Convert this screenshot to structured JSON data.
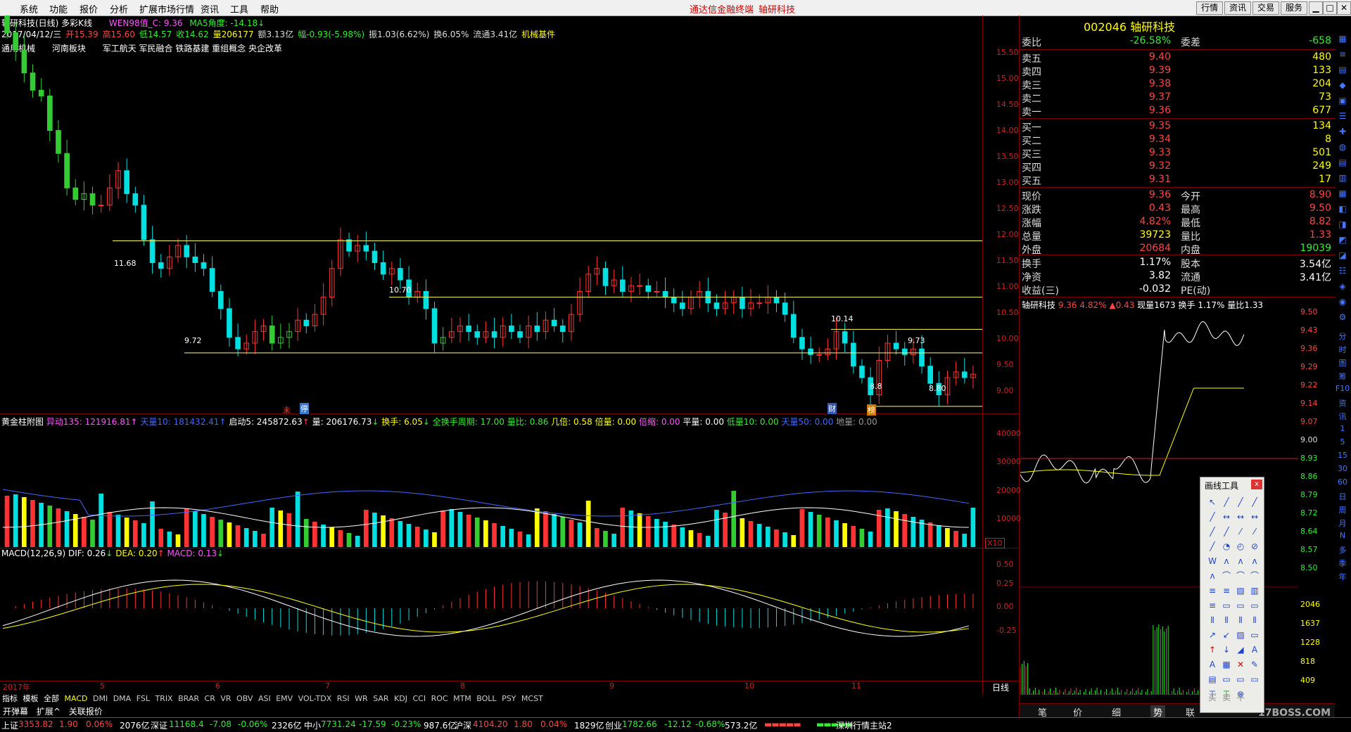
{
  "menu": {
    "items": [
      "系统",
      "功能",
      "报价",
      "分析",
      "扩展市场行情",
      "资讯",
      "工具",
      "帮助"
    ],
    "promo1": "通达信金融终端",
    "promo2": "轴研科技",
    "buttons": [
      "行情",
      "资讯",
      "交易",
      "服务"
    ]
  },
  "chart_header": {
    "title": "轴研科技(日线) 多彩K线",
    "wen": "WEN98值_C: 9.36",
    "ma5": "MA5角度: -14.18"
  },
  "day_info": {
    "date": "2017/04/12/三",
    "open": "开15.39",
    "high": "高15.60",
    "low": "低14.57",
    "close": "收14.62",
    "vol": "量206177",
    "amt": "额3.13亿",
    "chg": "幅-0.93(-5.98%)",
    "amp": "振1.03(6.62%)",
    "turn": "换6.05%",
    "float": "流通3.41亿",
    "industry": "机械基件"
  },
  "concepts": {
    "a": "通用机械",
    "b": "河南板块",
    "c": "军工航天 军民融合 铁路基建 重组概念 央企改革"
  },
  "price_axis": [
    "15.50",
    "15.00",
    "14.50",
    "14.00",
    "13.50",
    "13.00",
    "12.50",
    "12.00",
    "11.50",
    "11.00",
    "10.50",
    "10.00",
    "9.50",
    "9.00"
  ],
  "level_labels": {
    "l1": "11.68",
    "l2": "10.70",
    "l3": "10.14",
    "l4": "9.73",
    "l5": "9.72",
    "l6": "8.80",
    "l7": "8.8"
  },
  "event_markers": {
    "m1": "未",
    "m2": "停",
    "m3": "财",
    "m4": "榜"
  },
  "vol_ind": {
    "name": "黄金柱附图",
    "i1": "异动135: 121916.81",
    "i2": "天量10: 181432.41",
    "i3": "启动5: 245872.63",
    "i4": "量: 206176.73",
    "i5": "换手: 6.05",
    "i6": "全换手周期: 17.00",
    "i7": "量比: 0.86",
    "i8": "几倍: 0.58",
    "i9": "倍量: 0.00",
    "i10": "倍缩: 0.00",
    "i11": "平量: 0.00",
    "i12": "低量10: 0.00",
    "i13": "天量50: 0.00",
    "i14": "地量: 0.00"
  },
  "vol_axis": [
    "40000",
    "30000",
    "20000",
    "10000",
    "X10"
  ],
  "macd": {
    "name": "MACD(12,26,9)",
    "dif": "DIF: 0.26",
    "dea": "DEA: 0.20",
    "macd": "MACD: 0.13"
  },
  "macd_axis": [
    "0.50",
    "0.25",
    "0.00",
    "-0.25"
  ],
  "time_axis": [
    "2017年",
    "5",
    "6",
    "7",
    "8",
    "9",
    "10",
    "11"
  ],
  "period_label": "日线",
  "indicator_tabs": [
    "指标",
    "模板",
    "全部",
    "MACD",
    "DMI",
    "DMA",
    "FSL",
    "TRIX",
    "BRAR",
    "CR",
    "VR",
    "OBV",
    "ASI",
    "EMV",
    "VOL-TDX",
    "RSI",
    "WR",
    "SAR",
    "KDJ",
    "CCI",
    "ROC",
    "MTM",
    "BOLL",
    "PSY",
    "MCST"
  ],
  "bottom_tabs": [
    "开弹幕",
    "扩展^",
    "关联报价"
  ],
  "quote": {
    "code_name": "002046 轴研科技",
    "webi": {
      "l": "委比",
      "v": "-26.58%",
      "l2": "委差",
      "v2": "-658"
    },
    "asks": [
      {
        "l": "卖五",
        "p": "9.40",
        "v": "480"
      },
      {
        "l": "卖四",
        "p": "9.39",
        "v": "133"
      },
      {
        "l": "卖三",
        "p": "9.38",
        "v": "204"
      },
      {
        "l": "卖二",
        "p": "9.37",
        "v": "73"
      },
      {
        "l": "卖一",
        "p": "9.36",
        "v": "677"
      }
    ],
    "bids": [
      {
        "l": "买一",
        "p": "9.35",
        "v": "134"
      },
      {
        "l": "买二",
        "p": "9.34",
        "v": "8"
      },
      {
        "l": "买三",
        "p": "9.33",
        "v": "501"
      },
      {
        "l": "买四",
        "p": "9.32",
        "v": "249"
      },
      {
        "l": "买五",
        "p": "9.31",
        "v": "17"
      }
    ],
    "stats": [
      {
        "l": "现价",
        "v": "9.36",
        "l2": "今开",
        "v2": "8.90"
      },
      {
        "l": "涨跌",
        "v": "0.43",
        "l2": "最高",
        "v2": "9.50"
      },
      {
        "l": "涨幅",
        "v": "4.82%",
        "l2": "最低",
        "v2": "8.82"
      },
      {
        "l": "总量",
        "v": "39723",
        "l2": "量比",
        "v2": "1.33"
      },
      {
        "l": "外盘",
        "v": "20684",
        "l2": "内盘",
        "v2": "19039"
      }
    ],
    "stats2": [
      {
        "l": "换手",
        "v": "1.17%",
        "l2": "股本",
        "v2": "3.54亿"
      },
      {
        "l": "净资",
        "v": "3.82",
        "l2": "流通",
        "v2": "3.41亿"
      },
      {
        "l": "收益(三)",
        "v": "-0.032",
        "l2": "PE(动)",
        "v2": ""
      }
    ]
  },
  "intraday": {
    "name": "轴研科技",
    "price": "9.36",
    "pct": "4.82%",
    "chg": "▲0.43",
    "vol": "现量1673",
    "turn": "换手 1.17%",
    "ratio": "量比1.33",
    "axis": [
      "9.50",
      "9.43",
      "9.36",
      "9.29",
      "9.22",
      "9.14",
      "9.07",
      "9.00",
      "8.93",
      "8.86",
      "8.79",
      "8.72",
      "8.64",
      "8.57",
      "8.50"
    ],
    "vaxis": [
      "2046",
      "1637",
      "1228",
      "818",
      "409"
    ]
  },
  "tool_box": {
    "title": "画线工具",
    "close": "x"
  },
  "vtools": [
    "分",
    "时",
    "图",
    "筹",
    "F10",
    "资",
    "讯",
    "1",
    "5",
    "15",
    "30",
    "60",
    "日",
    "周",
    "月",
    "N",
    "多",
    "季",
    "年"
  ],
  "right_bottom_tabs": [
    "笔",
    "价",
    "细",
    "势",
    "联"
  ],
  "watermark": "17BOSS.COM",
  "status": {
    "sh": "上证",
    "sh_v": "3353.82",
    "sh_c": "1.90",
    "sh_p": "0.06%",
    "sh_a": "2076亿",
    "sz": "深证",
    "sz_v": "11168.4",
    "sz_c": "-7.08",
    "sz_p": "-0.06%",
    "sz_a": "2326亿",
    "zx": "中小",
    "zx_v": "7731.24",
    "zx_c": "-17.59",
    "zx_p": "-0.23%",
    "zx_a": "987.6亿",
    "hs": "沪深",
    "hs_v": "4104.20",
    "hs_c": "1.80",
    "hs_p": "0.04%",
    "hs_a": "1829亿",
    "cy": "创业",
    "cy_v": "1782.66",
    "cy_c": "-12.12",
    "cy_p": "-0.68%",
    "cy_a": "573.2亿",
    "station": "深圳行情主站2"
  },
  "chart_data": {
    "type": "candlestick",
    "title": "轴研科技(日线) 多彩K线",
    "ylim": [
      8.75,
      15.6
    ],
    "closes": [
      15.3,
      15.0,
      14.6,
      14.3,
      14.2,
      13.6,
      13.2,
      12.6,
      12.4,
      12.5,
      12.3,
      12.3,
      12.6,
      12.9,
      12.5,
      12.3,
      11.7,
      11.3,
      11.2,
      11.4,
      11.6,
      11.4,
      11.3,
      11.2,
      10.8,
      10.5,
      10.0,
      9.8,
      9.9,
      10.1,
      10.2,
      9.9,
      10.0,
      10.1,
      10.3,
      10.2,
      10.4,
      10.7,
      11.2,
      11.7,
      11.5,
      11.6,
      11.5,
      11.3,
      11.1,
      11.2,
      11.0,
      10.7,
      10.8,
      10.5,
      9.9,
      10.0,
      10.1,
      10.2,
      10.1,
      10.0,
      10.1,
      10.0,
      10.2,
      10.1,
      10.0,
      10.2,
      10.1,
      10.3,
      10.2,
      10.1,
      10.4,
      10.8,
      11.1,
      11.2,
      10.9,
      11.0,
      10.8,
      10.9,
      10.9,
      10.8,
      10.8,
      10.7,
      10.6,
      10.5,
      10.7,
      10.8,
      10.6,
      10.5,
      10.6,
      10.7,
      10.5,
      10.6,
      10.6,
      10.7,
      10.6,
      10.4,
      10.0,
      9.8,
      9.7,
      9.7,
      9.8,
      10.1,
      9.9,
      9.5,
      9.3,
      9.0,
      9.6,
      9.9,
      9.8,
      9.7,
      9.8,
      9.5,
      9.2,
      9.0,
      9.3,
      9.4,
      9.3,
      9.36
    ]
  },
  "colors": {
    "up": "#ff3333",
    "down": "#00e0e0",
    "ma_yellow": "#ffff00",
    "ma_white": "#ffffff",
    "green_block": "#33cc33",
    "axis_red": "#cc2222"
  }
}
